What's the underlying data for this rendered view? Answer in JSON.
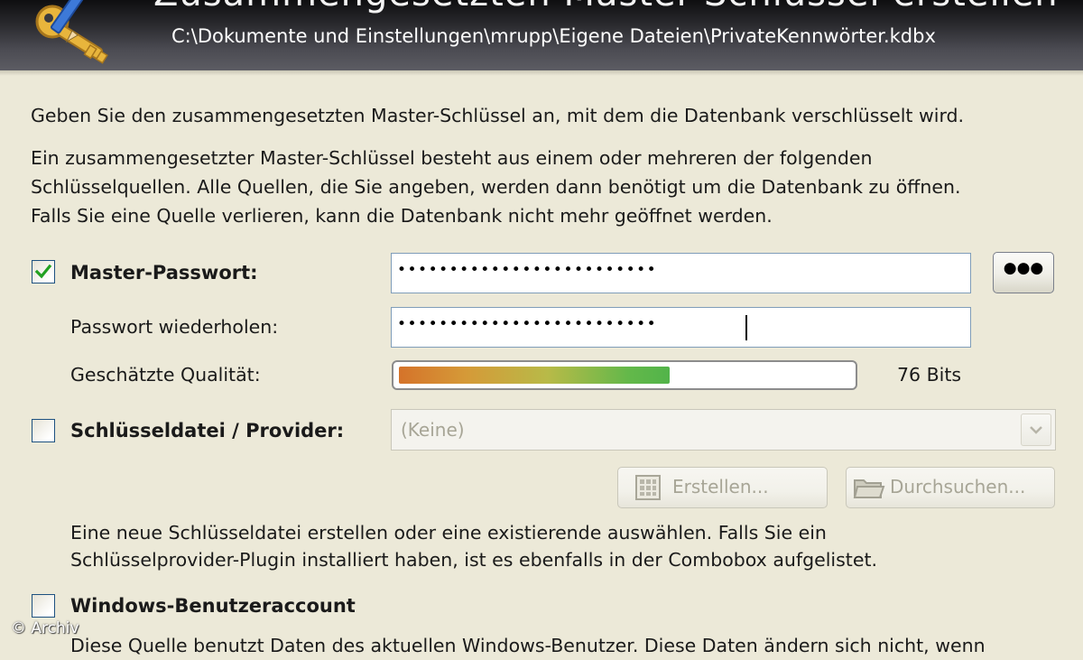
{
  "banner": {
    "title": "Zusammengesetzten Master-Schlüssel erstellen",
    "path": "C:\\Dokumente und Einstellungen\\mrupp\\Eigene Dateien\\PrivateKennwörter.kdbx"
  },
  "intro": {
    "line1": "Geben Sie den zusammengesetzten Master-Schlüssel an, mit dem die Datenbank verschlüsselt wird.",
    "line2": "Ein zusammengesetzter Master-Schlüssel besteht aus einem oder mehreren der folgenden",
    "line3": "Schlüsselquellen. Alle Quellen, die Sie angeben, werden dann benötigt um die Datenbank zu öffnen.",
    "line4": "Falls Sie eine Quelle verlieren, kann die Datenbank nicht mehr geöffnet werden."
  },
  "master_password": {
    "label": "Master-Passwort:",
    "checked": true,
    "value": "•••••••••••••••••••••••••",
    "toggle_button": "●●●"
  },
  "repeat_password": {
    "label": "Passwort wiederholen:",
    "value": "•••••••••••••••••••••••••"
  },
  "quality": {
    "label": "Geschätzte Qualität:",
    "bits_text": "76 Bits",
    "fill_fraction": 0.6
  },
  "keyfile": {
    "label": "Schlüsseldatei / Provider:",
    "checked": false,
    "combo_value": "(Keine)",
    "create_button": "Erstellen...",
    "browse_button": "Durchsuchen...",
    "desc1": "Eine neue Schlüsseldatei erstellen oder eine existierende auswählen. Falls Sie ein",
    "desc2": "Schlüsselprovider-Plugin installiert haben, ist es ebenfalls in der Combobox aufgelistet."
  },
  "windows_account": {
    "label": "Windows-Benutzeraccount",
    "checked": false,
    "desc1": "Diese Quelle benutzt Daten des aktuellen Windows-Benutzer. Diese Daten ändern sich nicht, wenn"
  },
  "watermark": "© Archiv",
  "icons": [
    "key-pencil-icon",
    "checkmark-icon",
    "chevron-down-icon",
    "grid-icon",
    "folder-icon"
  ],
  "colors": {
    "banner_dark": "#1c1c1e",
    "dialog_bg": "#ece9d8",
    "checkbox_border": "#1d5180",
    "checkmark": "#21a121"
  }
}
